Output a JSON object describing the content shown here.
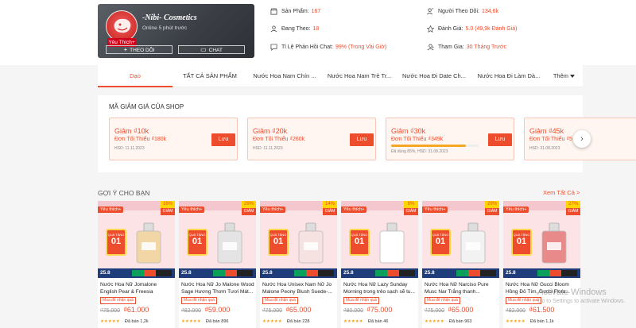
{
  "shop": {
    "name": "-Nibi- Cosmetics",
    "online": "Online 5 phút trước",
    "favorite_badge": "Yêu Thích+",
    "follow_label": "THEO DÕI",
    "chat_label": "CHAT"
  },
  "stats": [
    {
      "label": "Sản Phẩm:",
      "value": "167",
      "icon": "store-icon"
    },
    {
      "label": "Người Theo Dõi:",
      "value": "134,6k",
      "icon": "followers-icon"
    },
    {
      "label": "Đang Theo:",
      "value": "18",
      "icon": "following-icon"
    },
    {
      "label": "Đánh Giá:",
      "value": "5.0 (49,9k Đánh Giá)",
      "icon": "star-icon"
    },
    {
      "label": "Tỉ Lệ Phản Hồi Chat:",
      "value": "99% (Trong Vài Giờ)",
      "icon": "chat-icon"
    },
    {
      "label": "Tham Gia:",
      "value": "30 Tháng Trước",
      "icon": "join-icon"
    }
  ],
  "tabs": [
    "Dạo",
    "TẤT CẢ SẢN PHẨM",
    "Nước Hoa Nam Chín ...",
    "Nước Hoa Nam Trẻ Tr...",
    "Nước Hoa Đi Date Ch...",
    "Nước Hoa Đi Làm Dà...",
    "Thêm"
  ],
  "vouchers": {
    "title": "MÃ GIẢM GIÁ CỦA SHOP",
    "save_label": "Lưu",
    "items": [
      {
        "title": "Giảm ₫10k",
        "min": "Đơn Tối Thiểu ₫180k",
        "expiry": "HSD: 11.11.2023",
        "used": null
      },
      {
        "title": "Giảm ₫20k",
        "min": "Đơn Tối Thiểu ₫260k",
        "expiry": "HSD: 11.11.2023",
        "used": null
      },
      {
        "title": "Giảm ₫30k",
        "min": "Đơn Tối Thiểu ₫349k",
        "expiry": "Đã dùng 85%, HSD: 31.08.2023",
        "used": 0.85
      },
      {
        "title": "Giảm ₫45k",
        "min": "Đơn Tối Thiểu ₫5",
        "expiry": "HSD: 31.08.2023",
        "used": null
      }
    ]
  },
  "recommend": {
    "title": "GỢI Ý CHO BẠN",
    "see_all": "Xem Tất Cả >",
    "fav_tag": "Yêu thích+",
    "gift_tag": "QUÀ TẶNG",
    "gift_num": "01",
    "promo_date": "25.8",
    "discount_label": "GIẢM",
    "badge": "Mua để nhận quà",
    "products": [
      {
        "name": "Nước Hoa Nữ Jomalone English Pear & Freesia Cologne -...",
        "discount": "18%",
        "old": "₫75.000",
        "new": "₫61.000",
        "sold": "Đã bán 1,2k",
        "bottle_color": "#f3d6a6"
      },
      {
        "name": "Nước Hoa Nữ Jo Malone Wood Sage Hương Thơm Tươi Mát...",
        "discount": "29%",
        "old": "₫82.000",
        "new": "₫59.000",
        "sold": "Đã bán 896",
        "bottle_color": "#e4e4e4"
      },
      {
        "name": "Nước Hoa Unisex Nam Nữ Jo Malone Peony Blush Suede-...",
        "discount": "14%",
        "old": "₫75.000",
        "new": "₫65.000",
        "sold": "Đã bán 228",
        "bottle_color": "#f6e2e0"
      },
      {
        "name": "Nước Hoa Nữ Lazy Sunday Morning trong trẻo sạch sẽ tu...",
        "discount": "6%",
        "old": "₫80.000",
        "new": "₫75.000",
        "sold": "Đã bán 46",
        "bottle_color": "#ffffff"
      },
      {
        "name": "Nước Hoa Nữ Narciso Pure Musc Nar Trắng thanh...",
        "discount": "29%",
        "old": "₫75.000",
        "new": "₫65.000",
        "sold": "Đã bán 963",
        "bottle_color": "#f2f2f2"
      },
      {
        "name": "Nước Hoa Nữ Gucci Bloom Hồng Đỏ Tím, Gucci Flora...",
        "discount": "27%",
        "old": "₫82.000",
        "new": "₫61.500",
        "sold": "Đã bán 1,1k",
        "bottle_color": "#e98a8a"
      }
    ]
  },
  "watermark": {
    "line1": "Activate Windows",
    "line2": "Go to Settings to activate Windows."
  },
  "colors": {
    "accent": "#ee4d2d",
    "header_card": "#3a3e44",
    "promo_bar": "#1f3d7a"
  }
}
